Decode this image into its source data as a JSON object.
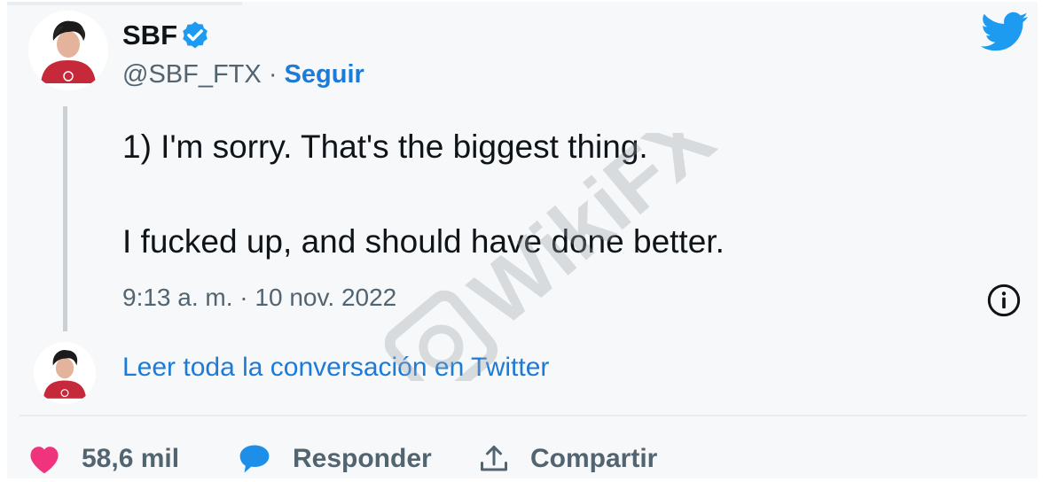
{
  "author": {
    "name": "SBF",
    "handle": "@SBF_FTX",
    "separator": "·",
    "follow_label": "Seguir",
    "verified": true
  },
  "tweet": {
    "line1": "1) I'm sorry.  That's the biggest thing.",
    "line2": "I fucked up, and should have done better.",
    "timestamp": "9:13 a. m. · 10 nov. 2022"
  },
  "read_more_label": "Leer toda la conversación en Twitter",
  "actions": {
    "likes": "58,6 mil",
    "reply_label": "Responder",
    "share_label": "Compartir"
  },
  "watermark": "WikiFX",
  "icons": {
    "verified": "verified-badge-icon",
    "logo": "twitter-bird-icon",
    "info": "info-icon",
    "like": "heart-icon",
    "reply": "speech-bubble-icon",
    "share": "share-upload-icon"
  },
  "colors": {
    "accent": "#1d7bd8",
    "twitter_blue": "#1d9bf0",
    "heart": "#f0337d",
    "muted": "#536471"
  }
}
